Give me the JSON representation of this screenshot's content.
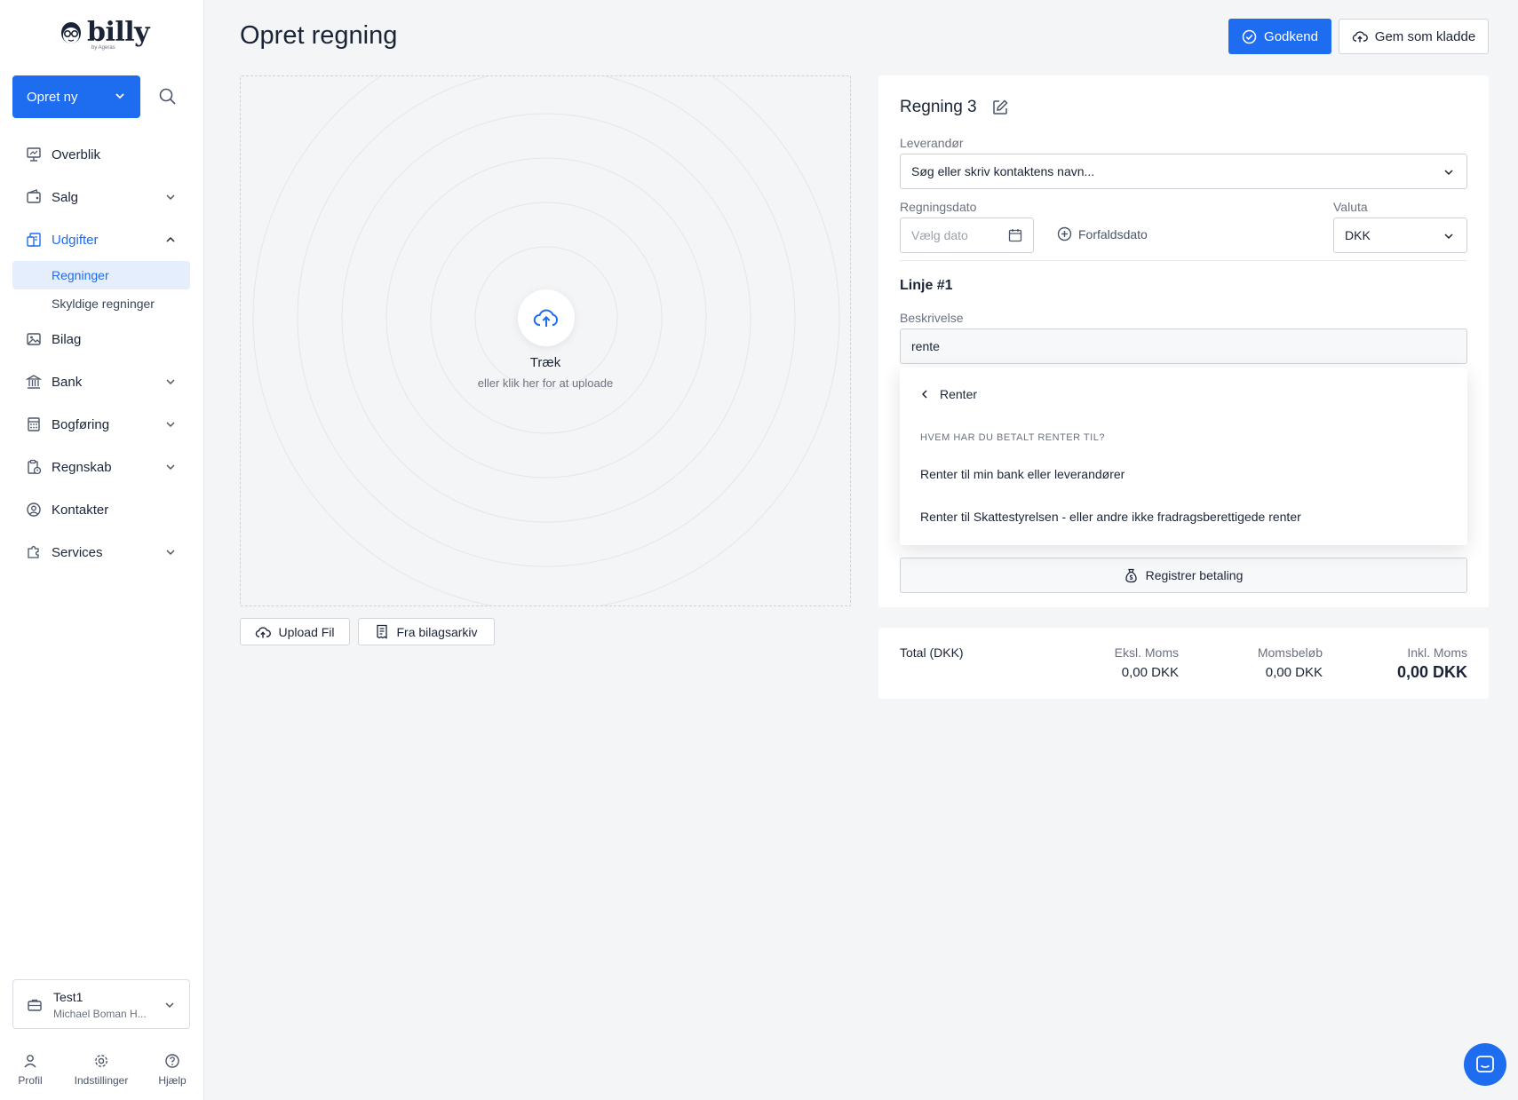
{
  "sidebar": {
    "logo_text": "billy",
    "logo_sub": "by Ageras",
    "create_button": "Opret ny",
    "nav": {
      "overview": "Overblik",
      "sales": "Salg",
      "expenses": "Udgifter",
      "bills": "Regninger",
      "owed_bills": "Skyldige regninger",
      "vouchers": "Bilag",
      "bank": "Bank",
      "bookkeeping": "Bogføring",
      "accounting": "Regnskab",
      "contacts": "Kontakter",
      "services": "Services"
    },
    "org": {
      "name": "Test1",
      "user": "Michael Boman H..."
    },
    "bottom": {
      "profile": "Profil",
      "settings": "Indstillinger",
      "help": "Hjælp"
    }
  },
  "header": {
    "title": "Opret regning",
    "approve_button": "Godkend",
    "draft_button": "Gem som kladde"
  },
  "dropzone": {
    "title": "Træk",
    "subtitle": "eller klik her for at uploade",
    "upload_button": "Upload Fil",
    "archive_button": "Fra bilagsarkiv"
  },
  "form": {
    "bill_title": "Regning 3",
    "supplier_label": "Leverandør",
    "supplier_placeholder": "Søg eller skriv kontaktens navn...",
    "date_label": "Regningsdato",
    "date_placeholder": "Vælg dato",
    "due_date_link": "Forfaldsdato",
    "currency_label": "Valuta",
    "currency_value": "DKK",
    "line_title": "Linje #1",
    "description_label": "Beskrivelse",
    "description_value": "rente",
    "register_payment": "Registrer betaling"
  },
  "dropdown": {
    "back_label": "Renter",
    "heading": "HVEM HAR DU BETALT RENTER TIL?",
    "options": [
      "Renter til min bank eller leverandører",
      "Renter til Skattestyrelsen - eller andre ikke fradragsberettigede renter"
    ]
  },
  "totals": {
    "label": "Total (DKK)",
    "excl_label": "Eksl. Moms",
    "excl_value": "0,00 DKK",
    "vat_label": "Momsbeløb",
    "vat_value": "0,00 DKK",
    "incl_label": "Inkl. Moms",
    "incl_value": "0,00 DKK"
  },
  "colors": {
    "accent": "#1e6cf0",
    "background": "#f4f5f7",
    "active_bg": "#e4eefc"
  }
}
